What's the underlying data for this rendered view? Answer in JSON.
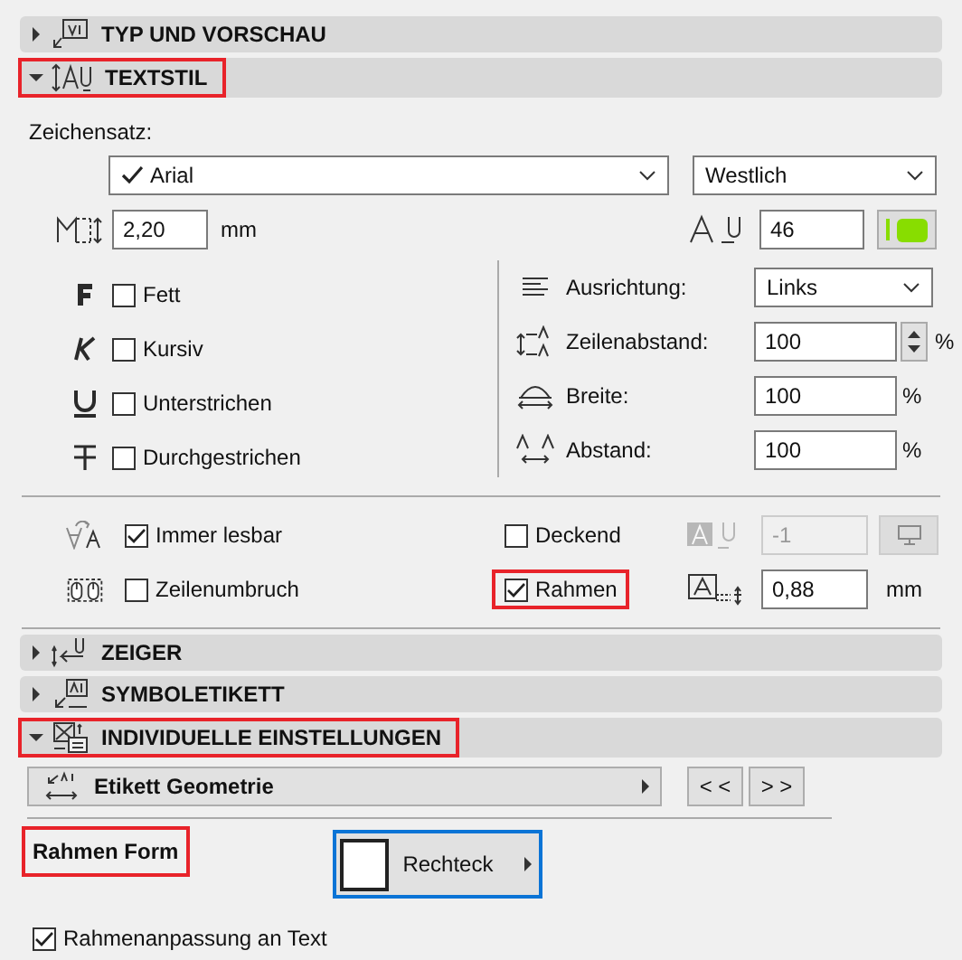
{
  "sections": [
    {
      "title": "TYP UND VORSCHAU",
      "expanded": false,
      "highlighted": false
    },
    {
      "title": "TEXTSTIL",
      "expanded": true,
      "highlighted": true,
      "body": {
        "kind": "text_style",
        "font_label": "Zeichensatz:",
        "font": {
          "value": "Arial",
          "checked": true
        },
        "charset": {
          "value": "Westlich"
        },
        "size": {
          "value": "2,20",
          "unit": "mm"
        },
        "pen": {
          "value": "46"
        },
        "styles": [
          {
            "label": "Fett",
            "checked": false
          },
          {
            "label": "Kursiv",
            "checked": false
          },
          {
            "label": "Unterstrichen",
            "checked": false
          },
          {
            "label": "Durchgestrichen",
            "checked": false
          }
        ],
        "paragraph": [
          {
            "kind": "dropdown",
            "label": "Ausrichtung:",
            "value": "Links"
          },
          {
            "kind": "spinner",
            "label": "Zeilenabstand:",
            "value": "100",
            "unit": "%"
          },
          {
            "kind": "input",
            "label": "Breite:",
            "value": "100",
            "unit": "%"
          },
          {
            "kind": "input",
            "label": "Abstand:",
            "value": "100",
            "unit": "%"
          }
        ],
        "options": [
          {
            "label": "Immer lesbar",
            "checked": true,
            "highlighted": false
          },
          {
            "label": "Deckend",
            "checked": false,
            "highlighted": false
          },
          {
            "label": "Zeilenumbruch",
            "checked": false,
            "highlighted": false
          },
          {
            "label": "Rahmen",
            "checked": true,
            "highlighted": true
          }
        ],
        "background_pen": {
          "value": "-1",
          "disabled": true
        },
        "frame_offset": {
          "value": "0,88",
          "unit": "mm"
        }
      }
    },
    {
      "title": "ZEIGER",
      "expanded": false,
      "highlighted": false
    },
    {
      "title": "SYMBOLETIKETT",
      "expanded": false,
      "highlighted": false
    },
    {
      "title": "INDIVIDUELLE EINSTELLUNGEN",
      "expanded": true,
      "highlighted": true,
      "body": {
        "kind": "individual",
        "page": {
          "label": "Etikett Geometrie"
        },
        "nav": [
          "< <",
          "> >"
        ],
        "frame_label": {
          "text": "Rahmen Form",
          "highlighted": true
        },
        "shape": {
          "label": "Rechteck"
        },
        "fit": {
          "label": "Rahmenanpassung an Text",
          "checked": true
        }
      }
    }
  ]
}
